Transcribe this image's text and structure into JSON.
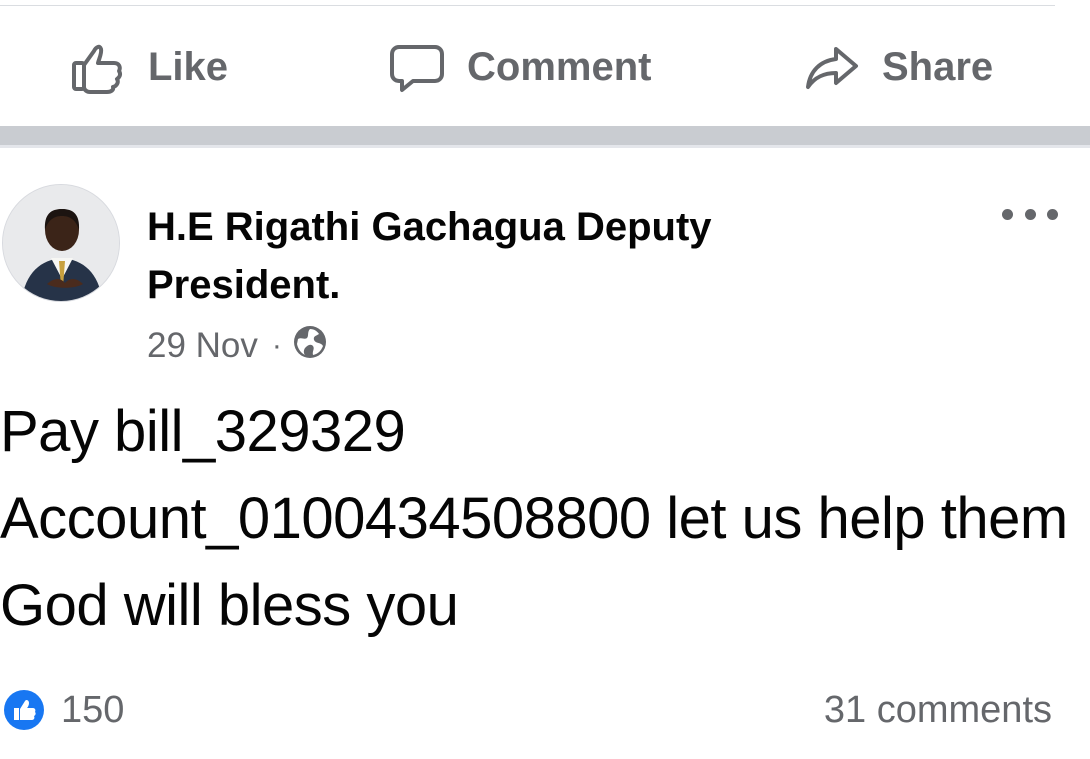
{
  "actions": {
    "like": "Like",
    "comment": "Comment",
    "share": "Share"
  },
  "post": {
    "author": "H.E Rigathi Gachagua Deputy President.",
    "date": "29 Nov",
    "separator": "·",
    "privacy_icon": "globe-icon",
    "text": "Pay bill_329329\nAccount_0100434508800 let us help them God will bless you",
    "reactions": {
      "icon": "thumbs-up-icon",
      "count": "150"
    },
    "comments": "31 comments"
  },
  "colors": {
    "secondary_text": "#65676b",
    "accent_blue": "#1877f2",
    "divider": "#c9ccd1"
  }
}
